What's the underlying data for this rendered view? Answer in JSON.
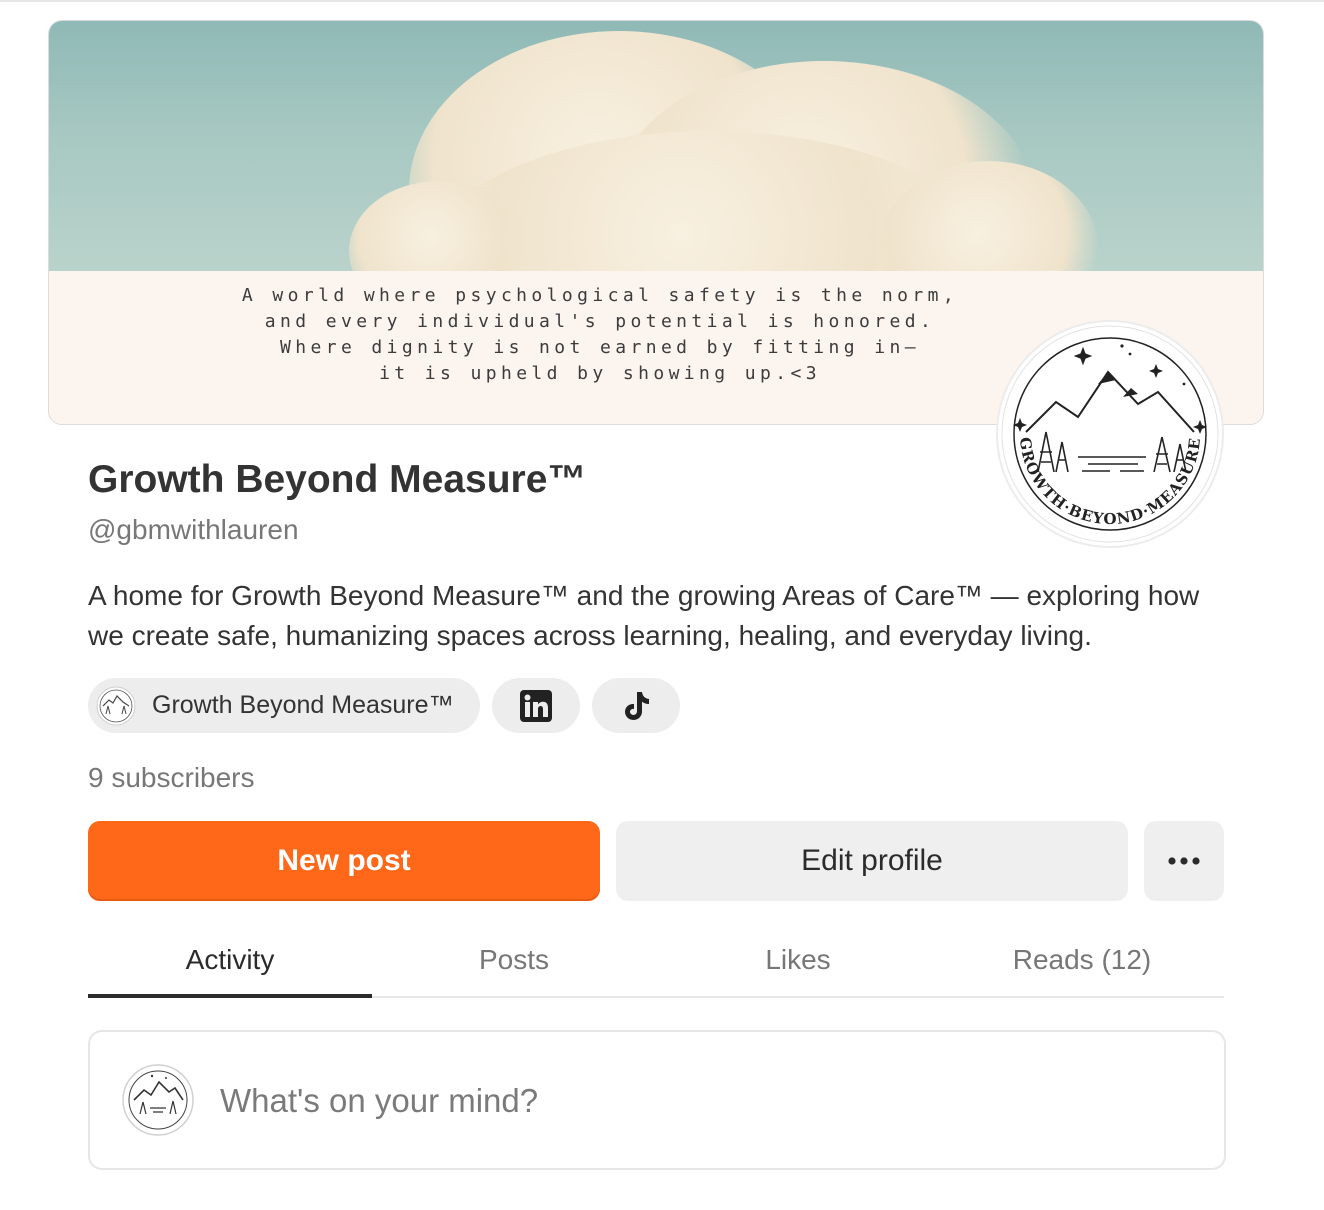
{
  "banner": {
    "quote_lines": [
      "A world where psychological safety is the norm,",
      "and every individual's potential is honored.",
      "Where dignity is not earned by fitting in—",
      "it is upheld by showing up.<3"
    ]
  },
  "logo": {
    "text": "GROWTH·BEYOND·MEASURE",
    "icon": "mountain-forest-logo-icon"
  },
  "profile": {
    "name": "Growth Beyond Measure™",
    "handle": "@gbmwithlauren",
    "bio": "A home for Growth Beyond Measure™ and the growing Areas of Care™ — exploring how we create safe, humanizing spaces across learning, healing, and everyday living.",
    "subscribers": "9 subscribers"
  },
  "links": {
    "site_label": "Growth Beyond Measure™",
    "linkedin_icon": "linkedin-icon",
    "tiktok_icon": "tiktok-icon"
  },
  "actions": {
    "new_post": "New post",
    "edit_profile": "Edit profile",
    "more_icon": "ellipsis-icon"
  },
  "tabs": [
    {
      "label": "Activity",
      "active": true
    },
    {
      "label": "Posts",
      "active": false
    },
    {
      "label": "Likes",
      "active": false
    },
    {
      "label": "Reads (12)",
      "active": false
    }
  ],
  "composer": {
    "placeholder": "What's on your mind?"
  },
  "colors": {
    "accent": "#ff6719",
    "chip_bg": "#ededed",
    "button_bg": "#efefef"
  }
}
